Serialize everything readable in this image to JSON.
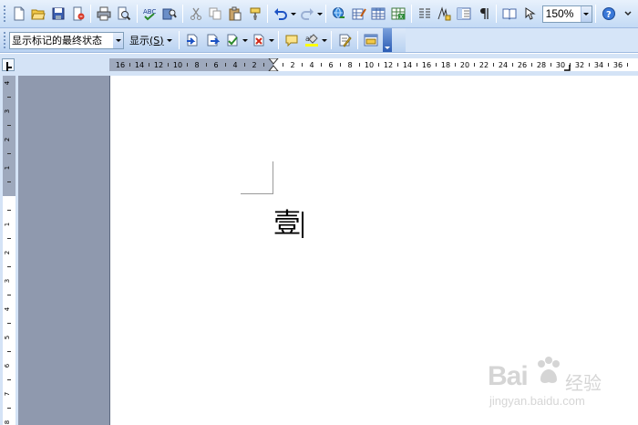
{
  "toolbar": {
    "zoom": "150%"
  },
  "review_toolbar": {
    "markup_view": "显示标记的最终状态",
    "show_label": "显示",
    "show_accel": "(S)"
  },
  "document": {
    "text": "壹"
  },
  "watermark": {
    "brand": "Bai",
    "brand_cn": "经验",
    "url": "jingyan.baidu.com"
  },
  "icons": [
    "new-document-icon",
    "open-folder-icon",
    "save-icon",
    "permission-icon",
    "print-icon",
    "print-preview-icon",
    "spelling-icon",
    "research-icon",
    "cut-icon",
    "copy-icon",
    "paste-icon",
    "format-painter-icon",
    "undo-icon",
    "redo-icon",
    "hyperlink-icon",
    "tables-borders-icon",
    "insert-table-icon",
    "insert-excel-icon",
    "columns-icon",
    "drawing-icon",
    "document-map-icon",
    "show-hide-icon",
    "help-icon",
    "previous-change-icon",
    "next-change-icon",
    "accept-change-icon",
    "reject-change-icon",
    "new-comment-icon",
    "highlight-icon",
    "track-changes-icon",
    "reviewing-pane-icon"
  ]
}
